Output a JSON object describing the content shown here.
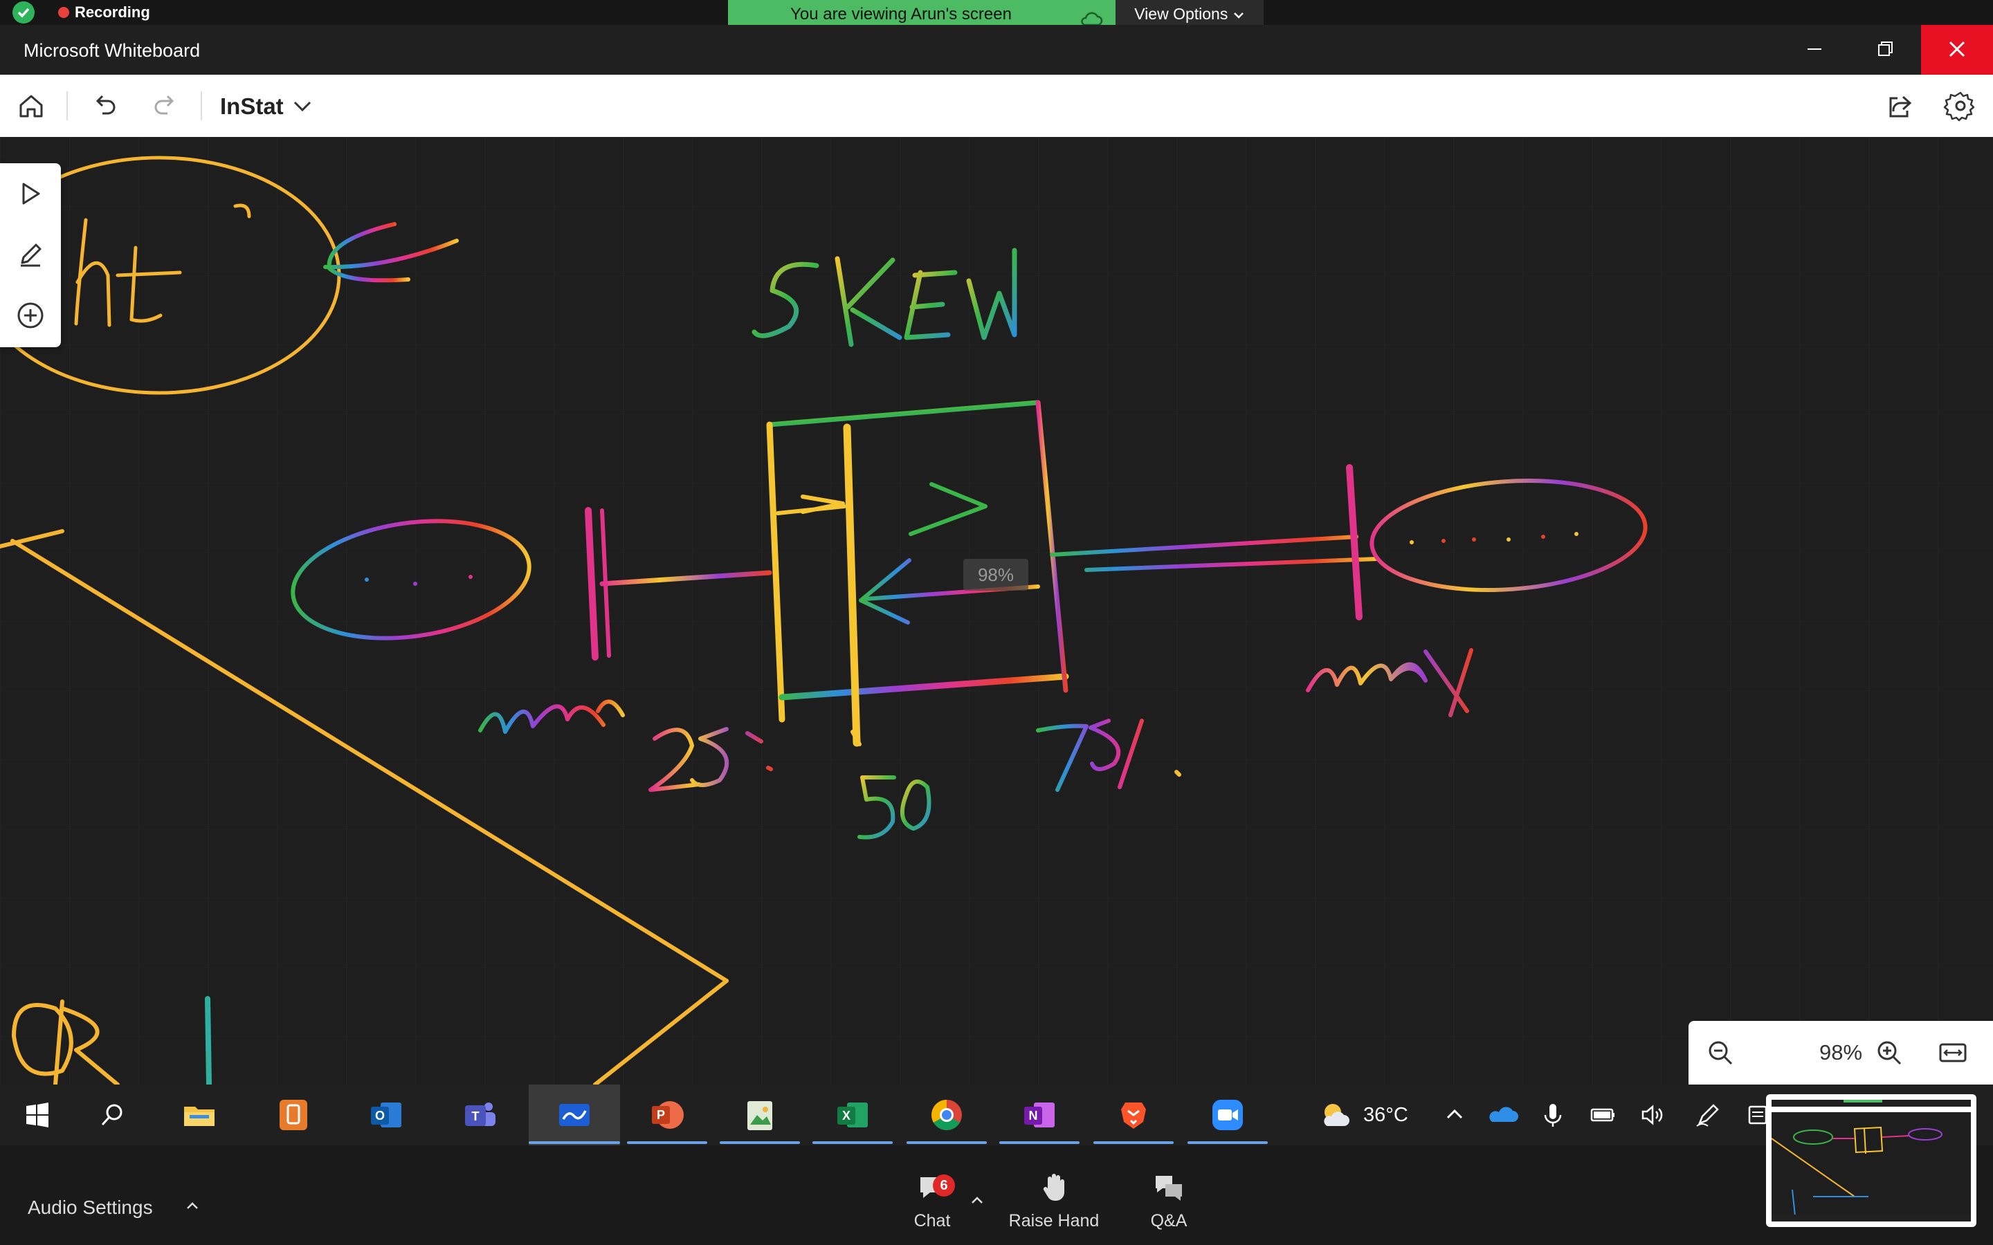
{
  "zoom_bar": {
    "recording": "Recording",
    "viewing_banner": "You are viewing Arun's screen",
    "view_options": "View Options"
  },
  "window": {
    "title": "Microsoft Whiteboard"
  },
  "toolbar": {
    "board_name": "InStat"
  },
  "canvas": {
    "zoom_overlay": "98%",
    "annotations": [
      "ht",
      "SKEW",
      "min",
      "max",
      "25%",
      "50",
      "75%",
      "QR"
    ]
  },
  "zoom_control": {
    "level": "98%"
  },
  "taskbar": {
    "apps": [
      "start",
      "search",
      "file-explorer",
      "contacts",
      "outlook",
      "teams",
      "whiteboard",
      "powerpoint",
      "photos",
      "excel",
      "chrome",
      "onenote",
      "brave",
      "zoom"
    ],
    "weather_temp": "36°C"
  },
  "zoom_bottom": {
    "audio_settings": "Audio Settings",
    "chat_label": "Chat",
    "chat_badge": "6",
    "raise_hand_label": "Raise Hand",
    "qa_label": "Q&A"
  },
  "colors": {
    "banner_green": "#4cbb63",
    "close_red": "#e81123",
    "ink_yellow": "#f5b531",
    "ink_rainbow_1": "#e8412c",
    "ink_rainbow_2": "#f5c631",
    "ink_rainbow_3": "#3ab54a",
    "ink_rainbow_4": "#2f8fd8",
    "ink_rainbow_5": "#9a3fd0",
    "ink_rainbow_6": "#e2338a"
  }
}
